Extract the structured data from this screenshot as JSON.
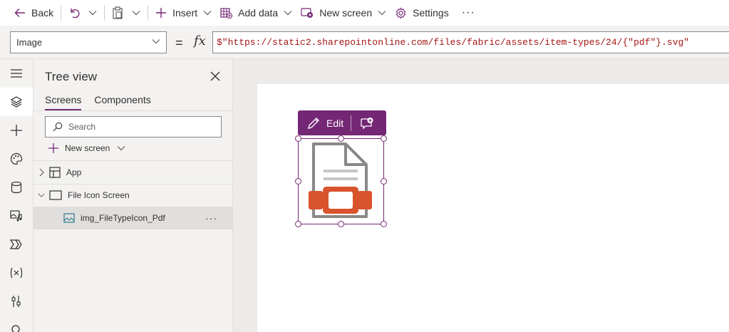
{
  "command_bar": {
    "back_label": "Back",
    "insert_label": "Insert",
    "add_data_label": "Add data",
    "new_screen_label": "New screen",
    "settings_label": "Settings",
    "more_label": "···"
  },
  "formula_bar": {
    "property": "Image",
    "equals": "=",
    "fx": "fx",
    "formula": "$\"https://static2.sharepointonline.com/files/fabric/assets/item-types/24/{\"pdf\"}.svg\""
  },
  "rail": {
    "icons": [
      "hamburger-icon",
      "tree-view-icon",
      "insert-icon",
      "theme-icon",
      "data-icon",
      "media-icon",
      "power-automate-icon",
      "variables-icon",
      "advanced-tools-icon",
      "search-icon"
    ]
  },
  "tree": {
    "title": "Tree view",
    "tabs": [
      "Screens",
      "Components"
    ],
    "search_placeholder": "Search",
    "new_screen_label": "New screen",
    "items": [
      {
        "label": "App"
      },
      {
        "label": "File Icon Screen"
      },
      {
        "label": "img_FileTypeIcon_Pdf"
      }
    ],
    "more_label": "···"
  },
  "canvas": {
    "edit_label": "Edit",
    "colors": {
      "accent": "#742774",
      "pdf_red": "#d9532c",
      "doc_gray": "#8a8886"
    }
  }
}
